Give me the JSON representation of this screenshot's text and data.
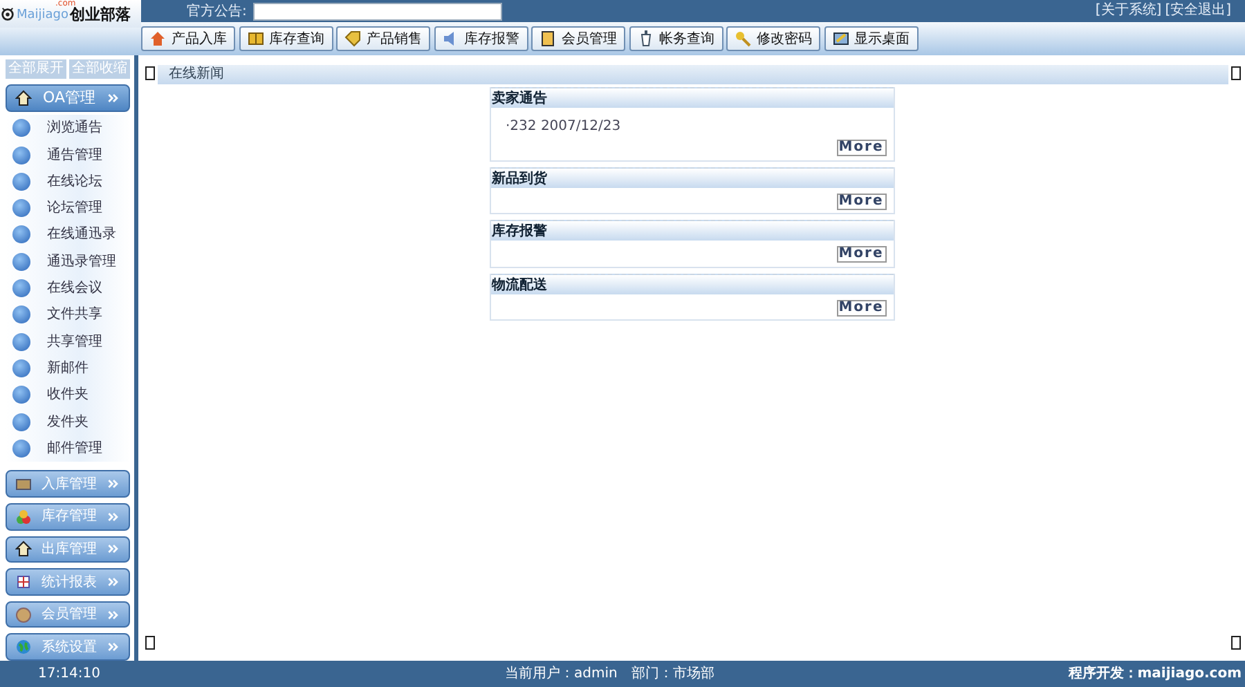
{
  "header": {
    "logo_brand": "Maijiago",
    "logo_text": "创业部落",
    "logo_small": ".com",
    "notice_label": "官方公告:",
    "links": [
      "[关于系统]",
      "[安全退出]"
    ]
  },
  "toolbar": [
    "产品入库",
    "库存查询",
    "产品销售",
    "库存报警",
    "会员管理",
    "帐务查询",
    "修改密码",
    "显示桌面"
  ],
  "sidebar": {
    "controls": [
      "全部展开",
      "全部收缩"
    ],
    "groups": [
      {
        "title": "OA管理",
        "expanded": true,
        "items": [
          "浏览通告",
          "通告管理",
          "在线论坛",
          "论坛管理",
          "在线通迅录",
          "通迅录管理",
          "在线会议",
          "文件共享",
          "共享管理",
          "新邮件",
          "收件夹",
          "发件夹",
          "邮件管理"
        ]
      },
      {
        "title": "入库管理",
        "expanded": false
      },
      {
        "title": "库存管理",
        "expanded": false
      },
      {
        "title": "出库管理",
        "expanded": false
      },
      {
        "title": "统计报表",
        "expanded": false
      },
      {
        "title": "会员管理",
        "expanded": false
      },
      {
        "title": "系统设置",
        "expanded": false
      }
    ]
  },
  "content": {
    "title": "在线新闻",
    "panels": [
      {
        "title": "卖家通告",
        "entries": [
          "·232 2007/12/23"
        ],
        "button": "More"
      },
      {
        "title": "新品到货",
        "button": "More"
      },
      {
        "title": "库存报警",
        "button": "More"
      },
      {
        "title": "物流配送",
        "button": "More"
      }
    ]
  },
  "status_bar": {
    "time": "17:14:10",
    "user": "当前用户：admin",
    "department": "部门：市场部",
    "credit": "程序开发：maijiago.com"
  }
}
